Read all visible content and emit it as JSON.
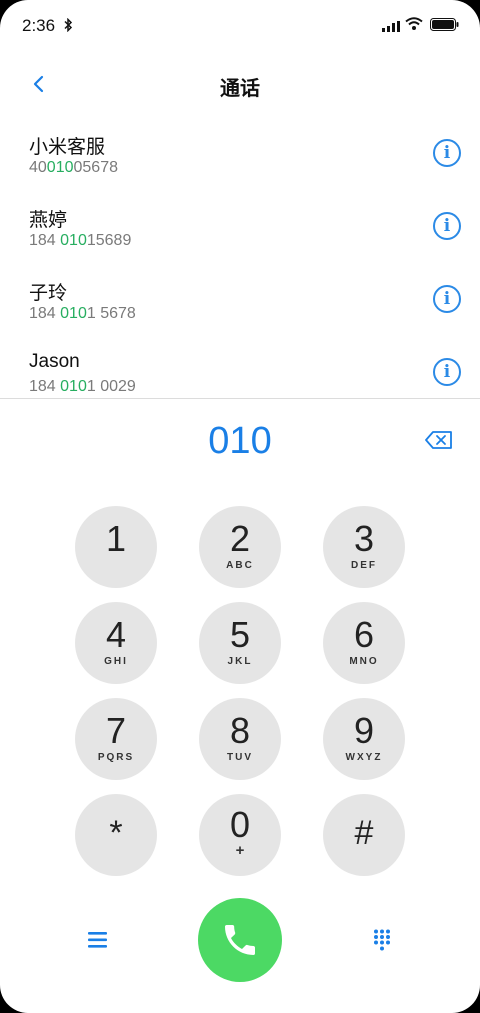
{
  "status_bar": {
    "time": "2:36"
  },
  "header": {
    "title": "通话"
  },
  "contacts": [
    {
      "name": "小米客服",
      "number_pre": "40",
      "number_match": "010",
      "number_post": "05678"
    },
    {
      "name": "燕婷",
      "number_pre": "184 ",
      "number_match": "010",
      "number_post": "15689"
    },
    {
      "name": "子玲",
      "number_pre": "184 ",
      "number_match": "010",
      "number_post": "1 5678"
    },
    {
      "name": "Jason",
      "number_pre": "184 ",
      "number_match": "010",
      "number_post": "1 0029"
    }
  ],
  "info_glyph": "i",
  "dialed_number": "010",
  "keypad": [
    {
      "digit": "1",
      "letters": ""
    },
    {
      "digit": "2",
      "letters": "ABC"
    },
    {
      "digit": "3",
      "letters": "DEF"
    },
    {
      "digit": "4",
      "letters": "GHI"
    },
    {
      "digit": "5",
      "letters": "JKL"
    },
    {
      "digit": "6",
      "letters": "MNO"
    },
    {
      "digit": "7",
      "letters": "PQRS"
    },
    {
      "digit": "8",
      "letters": "TUV"
    },
    {
      "digit": "9",
      "letters": "WXYZ"
    },
    {
      "digit": "*",
      "letters": ""
    },
    {
      "digit": "0",
      "letters": "+"
    },
    {
      "digit": "#",
      "letters": ""
    }
  ],
  "colors": {
    "accent_blue": "#1a7fe6",
    "match_green": "#27ae60",
    "call_green": "#4cd964",
    "key_gray": "#e5e5e5"
  },
  "icons": [
    "bluetooth-icon",
    "signal-icon",
    "wifi-icon",
    "battery-icon",
    "back-arrow-icon",
    "info-icon",
    "backspace-icon",
    "menu-icon",
    "phone-icon",
    "dialpad-icon"
  ]
}
